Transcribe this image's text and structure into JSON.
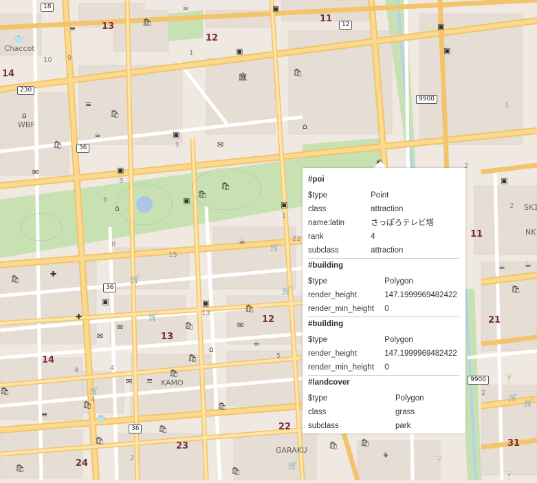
{
  "block_labels": [
    "13",
    "12",
    "11",
    "14",
    "13",
    "11",
    "12",
    "13",
    "14",
    "21",
    "22",
    "23",
    "24",
    "31"
  ],
  "place_labels": [
    "Chaccot",
    "WBF",
    "KAMO",
    "GARAKU",
    "SK1",
    "NK"
  ],
  "number_labels": [
    "10",
    "9",
    "1",
    "3",
    "3",
    "6",
    "8",
    "1",
    "22",
    "15",
    "13",
    "4",
    "4",
    "4",
    "5",
    "2",
    "1",
    "2",
    "2",
    "2"
  ],
  "shields": [
    "18",
    "12",
    "230",
    "9900",
    "36",
    "36",
    "36",
    "9900"
  ],
  "map_icons": [
    "cafe-icon",
    "shopping-icon",
    "bus-icon",
    "bank-icon",
    "restaurant-icon",
    "hotel-icon",
    "cart-icon",
    "bar-icon",
    "clothes-icon",
    "hospital-icon",
    "mail-icon",
    "museum-icon",
    "bakery-icon"
  ],
  "popup": {
    "sections": [
      {
        "title": "#poi",
        "rows": [
          {
            "key": "$type",
            "value": "Point"
          },
          {
            "key": "class",
            "value": "attraction"
          },
          {
            "key": "name:latin",
            "value": "さっぽろテレビ塔"
          },
          {
            "key": "rank",
            "value": "4"
          },
          {
            "key": "subclass",
            "value": "attraction"
          }
        ]
      },
      {
        "title": "#building",
        "rows": [
          {
            "key": "$type",
            "value": "Polygon"
          },
          {
            "key": "render_height",
            "value": "147.1999969482422"
          },
          {
            "key": "render_min_height",
            "value": "0"
          }
        ]
      },
      {
        "title": "#building",
        "rows": [
          {
            "key": "$type",
            "value": "Polygon"
          },
          {
            "key": "render_height",
            "value": "147.1999969482422"
          },
          {
            "key": "render_min_height",
            "value": "0"
          }
        ]
      },
      {
        "title": "#landcover",
        "rows": [
          {
            "key": "$type",
            "value": "Polygon"
          },
          {
            "key": "class",
            "value": "grass"
          },
          {
            "key": "subclass",
            "value": "park"
          }
        ]
      }
    ]
  },
  "colors": {
    "road_major": "#fbd582",
    "road_minor": "#ffffff",
    "park": "#c7e1b3",
    "building": "#e5ddd6",
    "background": "#efe9e2",
    "canal": "#b3d3e8",
    "block_label": "#7a2e3d"
  }
}
